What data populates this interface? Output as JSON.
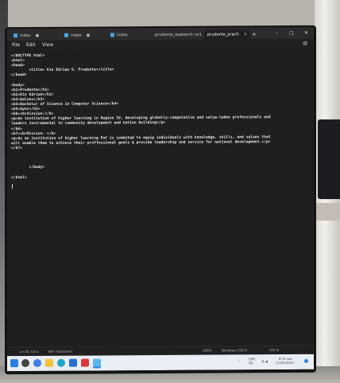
{
  "tabs": [
    {
      "label": "Index",
      "modified": "●"
    },
    {
      "label": "Index",
      "modified": "●"
    },
    {
      "label": "Index",
      "modified": ""
    },
    {
      "label": "prudente_seatwork no1",
      "modified": ""
    },
    {
      "label": "prudente_practi",
      "modified": "✕"
    }
  ],
  "window": {
    "new_tab": "+",
    "minimize": "–",
    "maximize": "□",
    "close": "✕"
  },
  "menu": {
    "file": "File",
    "edit": "Edit",
    "view": "View"
  },
  "code_lines": [
    "<!DOCTYPE html>",
    "<html>",
    "<head>",
    "        <title> Kin Edrian G. Prudente</title>",
    "</head>",
    "",
    "<body>",
    "<h1>Prudente</h1>",
    "<h2>Kin Edrian</h2>",
    "<h3>Galvez</h3>",
    "<h4>Bachelor of Science in Computer Science</h4>",
    "<h5>Gyec</h5>",
    "<h6><b>Vission:</b>",
    "<p>An institution of higher learning in Region IV, developing globally-competative and value-laden professionals and",
    "leaders instrumental to community development and nation building</p>",
    "</h6>",
    "<h7><b>Mission: </b>",
    "<p>As an institution of higher learning PnC is commited to equip individuals with knowledge, skills, and values that",
    "will enable them to achieve their proffessional goals & provide leadership and service for national development.</p>",
    "</h7>",
    "",
    "",
    "",
    "        </body>",
    "",
    "</html>"
  ],
  "status": {
    "position": "Ln 20, Col 1",
    "characters": "687 characters",
    "zoom": "100%",
    "line_ending": "Windows (CRLF)",
    "encoding": "UTF-8"
  },
  "tray": {
    "lang1": "ENG",
    "lang2": "US",
    "time": "8:31 am",
    "date": "17/01/2023"
  },
  "colors": {
    "editor_bg": "#1f1f1f",
    "accent": "#2b7de1"
  }
}
